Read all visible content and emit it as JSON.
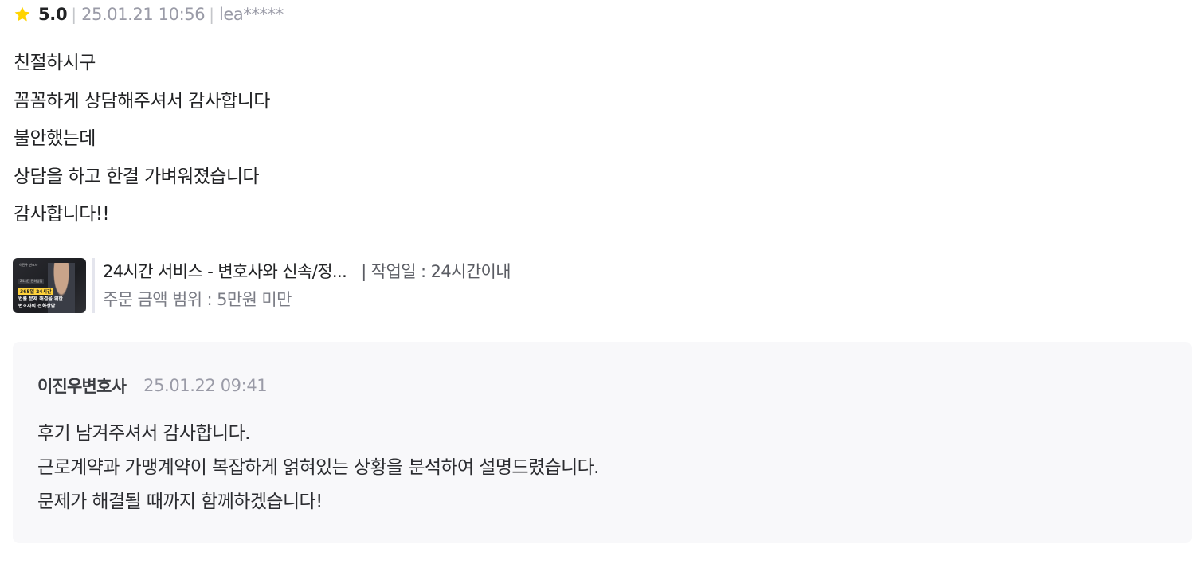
{
  "review": {
    "star_icon": "star-icon",
    "star_color": "#ffd400",
    "rating": "5.0",
    "separator": "|",
    "date": "25.01.21 10:56",
    "user": "lea*****",
    "lines": [
      "친절하시구",
      "꼼꼼하게 상담해주셔서 감사합니다",
      "불안했는데",
      "상담을 하고 한결 가벼워졌습니다",
      "감사합니다!!"
    ]
  },
  "service": {
    "thumbnail_lines": [
      "이진우 변호사",
      "24시간 전화상담",
      "365일 24시간",
      "법률 문제 해결을 위한",
      "변호사의 전화상담"
    ],
    "title": "24시간 서비스 - 변호사와 신속/정...",
    "separator": "|",
    "work_period": "작업일 : 24시간이내",
    "price_range": "주문 금액 범위 : 5만원 미만"
  },
  "reply": {
    "author": "이진우변호사",
    "date": "25.01.22 09:41",
    "lines": [
      "후기 남겨주셔서 감사합니다.",
      "근로계약과 가맹계약이 복잡하게 얽혀있는 상황을 분석하여 설명드렸습니다.",
      "문제가 해결될 때까지 함께하겠습니다!"
    ]
  }
}
